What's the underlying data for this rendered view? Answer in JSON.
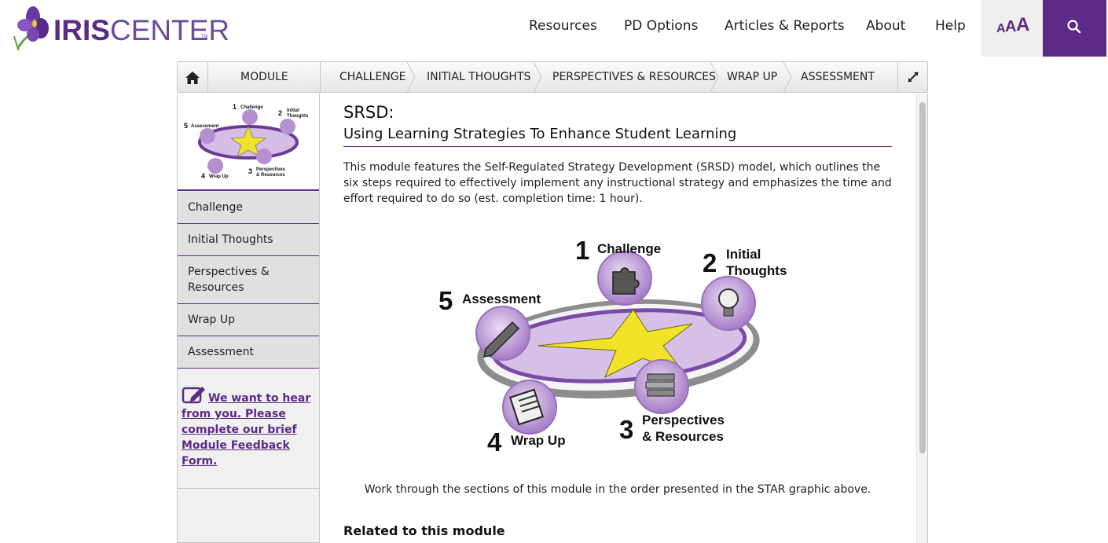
{
  "logo": {
    "bold": "IRIS",
    "light": "CENTER",
    "tm": "TM"
  },
  "nav": {
    "items": [
      "Resources",
      "PD Options",
      "Articles & Reports",
      "About",
      "Help"
    ],
    "text_size_label": [
      "A",
      "A",
      "A"
    ]
  },
  "module_bar": {
    "module_label": "MODULE",
    "crumbs": [
      "CHALLENGE",
      "INITIAL THOUGHTS",
      "PERSPECTIVES & RESOURCES",
      "WRAP UP",
      "ASSESSMENT"
    ]
  },
  "thumb_labels": {
    "challenge": "Challenge",
    "initial": "Initial",
    "thoughts": "Thoughts",
    "assessment": "Assessment",
    "wrap": "Wrap Up",
    "perspectives": "Perspectives",
    "resources": "& Resources"
  },
  "sidebar": {
    "items": [
      "Challenge",
      "Initial Thoughts",
      "Perspectives & Resources",
      "Wrap Up",
      "Assessment"
    ],
    "feedback_link": "We want to hear from you. Please complete our brief Module Feedback Form."
  },
  "main": {
    "title": "SRSD:",
    "subtitle": "Using Learning Strategies To Enhance Student Learning",
    "intro": "This module features the Self-Regulated Strategy Development (SRSD) model, which outlines the six steps required to effectively implement any instructional strategy and emphasizes the time and effort required to do so (est. completion time: 1 hour).",
    "star": {
      "n1": "1",
      "l1": "Challenge",
      "n2": "2",
      "l2a": "Initial",
      "l2b": "Thoughts",
      "n3": "3",
      "l3a": "Perspectives",
      "l3b": "& Resources",
      "n4": "4",
      "l4": "Wrap Up",
      "n5": "5",
      "l5": "Assessment"
    },
    "caption": "Work through the sections of this module in the order presented in the STAR graphic above.",
    "related_heading": "Related to this module"
  },
  "colors": {
    "brand_purple": "#5d2a87",
    "star_yellow": "#f2e227",
    "bubble_purple": "#b58fd0"
  }
}
